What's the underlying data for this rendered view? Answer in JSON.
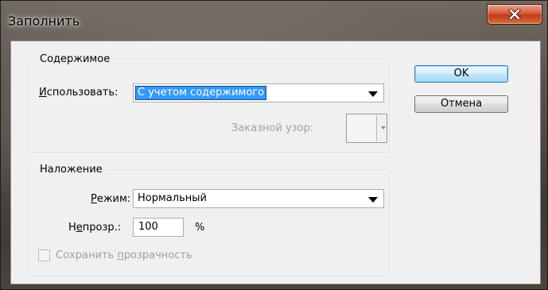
{
  "window": {
    "title": "Заполнить",
    "close_icon": "close-x-icon"
  },
  "content_group": {
    "legend": "Содержимое",
    "use_label_underlined": "И",
    "use_label_rest": "спользовать:",
    "use_value": "С учетом содержимого",
    "custom_pattern_label": "Заказной узор:"
  },
  "blend_group": {
    "legend": "Наложение",
    "mode_label_underlined": "Р",
    "mode_label_rest": "ежим:",
    "mode_value": "Нормальный",
    "opacity_label_pre": "Н",
    "opacity_label_underlined": "е",
    "opacity_label_rest": "прозр.:",
    "opacity_value": "100",
    "opacity_unit": "%",
    "preserve_label_pre": "Сохранить ",
    "preserve_label_underlined": "п",
    "preserve_label_rest": "розрачность",
    "preserve_checked": false
  },
  "buttons": {
    "ok": "OK",
    "cancel": "Отмена"
  },
  "colors": {
    "selection": "#3399ff",
    "default_button": "#bee6fd",
    "close_button": "#c2391a"
  }
}
